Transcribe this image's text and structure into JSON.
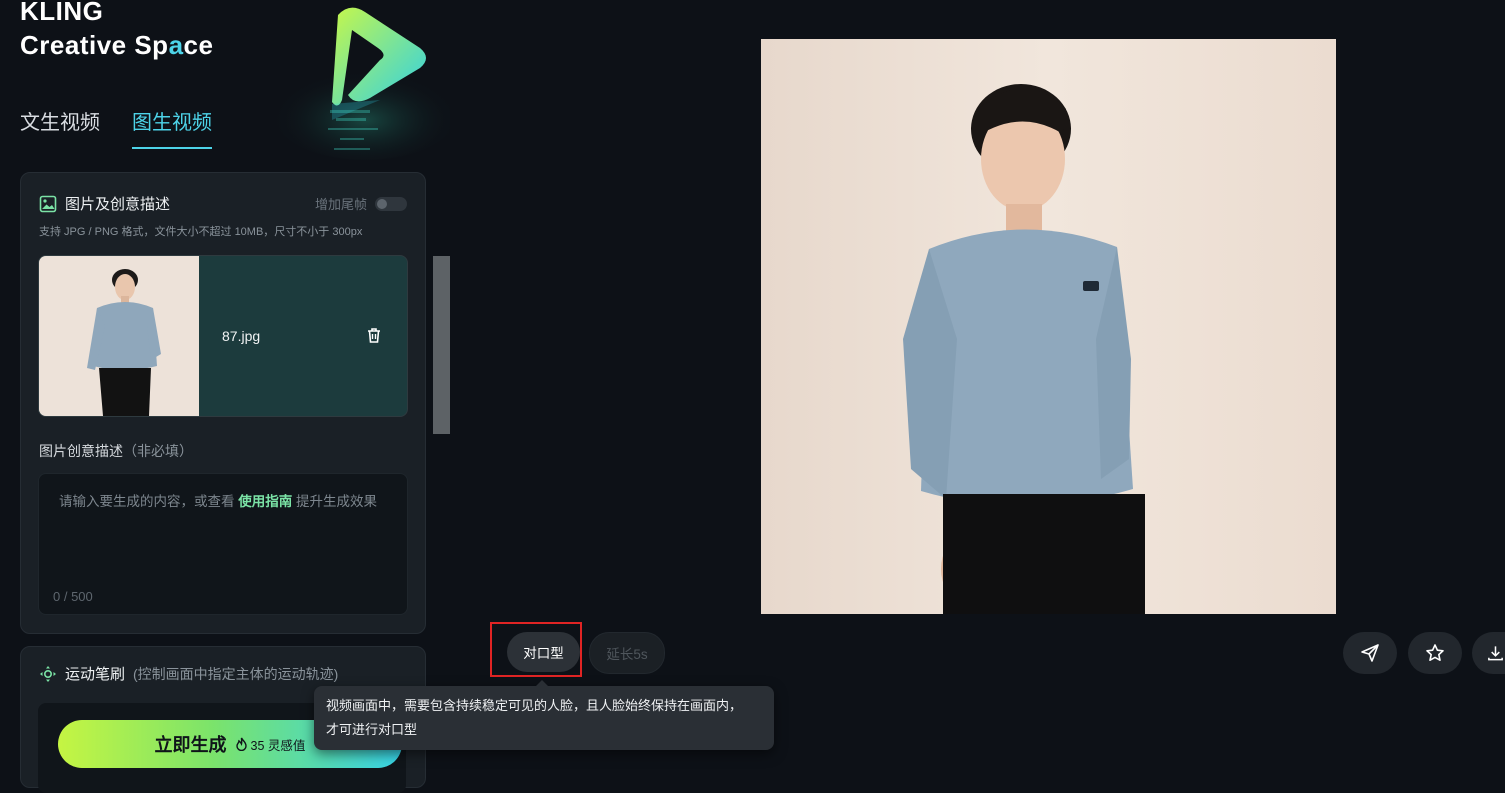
{
  "brand": {
    "line1": "KLING",
    "line2_a": "Creative Sp",
    "line2_b": "a",
    "line2_c": "ce"
  },
  "tabs": [
    {
      "label": "文生视频",
      "active": false
    },
    {
      "label": "图生视频",
      "active": true
    }
  ],
  "image_card": {
    "title": "图片及创意描述",
    "toggle_label": "增加尾帧",
    "toggle_on": false,
    "hint": "支持 JPG / PNG 格式，文件大小不超过 10MB，尺寸不小于 300px",
    "file_name": "87.jpg",
    "desc_label": "图片创意描述",
    "desc_optional": "（非必填）",
    "placeholder_a": "请输入要生成的内容，或查看 ",
    "placeholder_link": "使用指南",
    "placeholder_b": " 提升生成效果",
    "counter": "0 / 500"
  },
  "motion_card": {
    "title": "运动笔刷",
    "subtitle": "(控制画面中指定主体的运动轨迹)"
  },
  "generate": {
    "label": "立即生成",
    "cost": "35 灵感值"
  },
  "preview_actions": {
    "lip_sync": "对口型",
    "extend": "延长5s",
    "tooltip": "视频画面中，需要包含持续稳定可见的人脸，且人脸始终保持在画面内，才可进行对口型"
  },
  "colors": {
    "accent": "#4dd3e8",
    "link_green": "#7be3a6",
    "highlight_red": "#e02424",
    "background": "#0d1117"
  },
  "icons": [
    "image-icon",
    "trash-icon",
    "motion-brush-icon",
    "flame-icon",
    "send-icon",
    "star-icon",
    "download-icon",
    "logo-play-icon"
  ]
}
